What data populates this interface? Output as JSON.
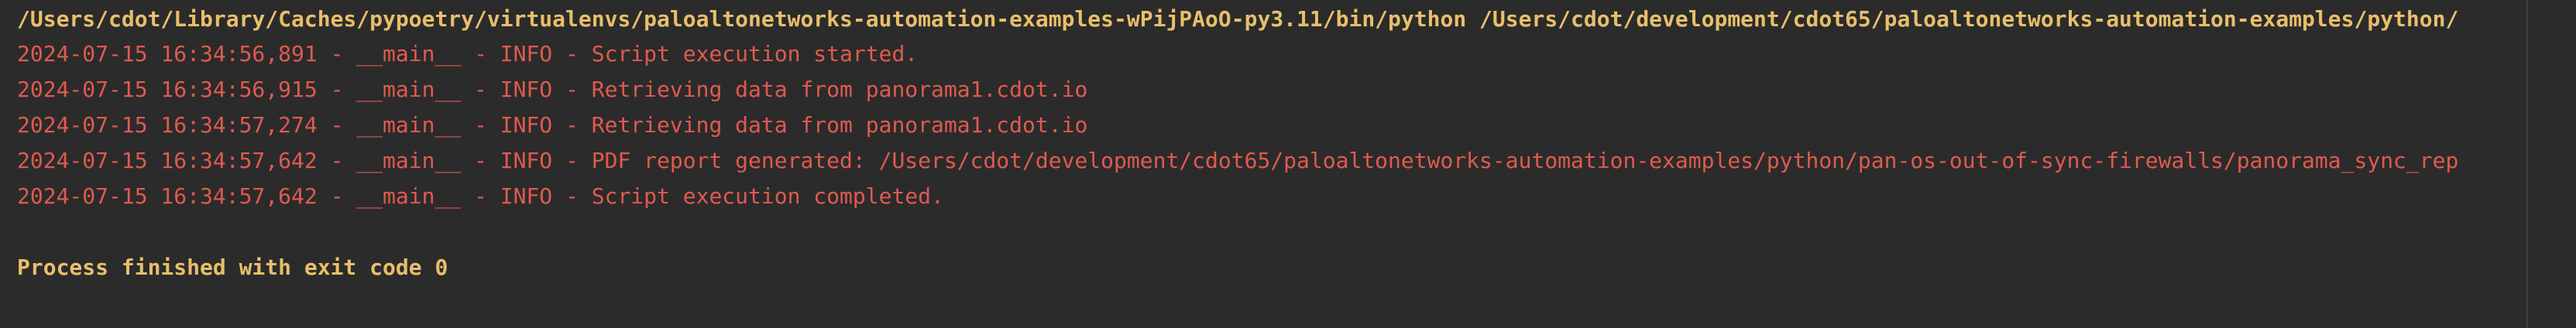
{
  "console": {
    "command_line": "/Users/cdot/Library/Caches/pypoetry/virtualenvs/paloaltonetworks-automation-examples-wPijPAoO-py3.11/bin/python /Users/cdot/development/cdot65/paloaltonetworks-automation-examples/python/",
    "log_lines": [
      "2024-07-15 16:34:56,891 - __main__ - INFO - Script execution started.",
      "2024-07-15 16:34:56,915 - __main__ - INFO - Retrieving data from panorama1.cdot.io",
      "2024-07-15 16:34:57,274 - __main__ - INFO - Retrieving data from panorama1.cdot.io",
      "2024-07-15 16:34:57,642 - __main__ - INFO - PDF report generated: /Users/cdot/development/cdot65/paloaltonetworks-automation-examples/python/pan-os-out-of-sync-firewalls/panorama_sync_rep",
      "2024-07-15 16:34:57,642 - __main__ - INFO - Script execution completed."
    ],
    "exit_message": "Process finished with exit code 0"
  },
  "colors": {
    "background": "#2b2b2b",
    "command_text": "#e8bf6a",
    "log_text": "#e05a4f"
  }
}
